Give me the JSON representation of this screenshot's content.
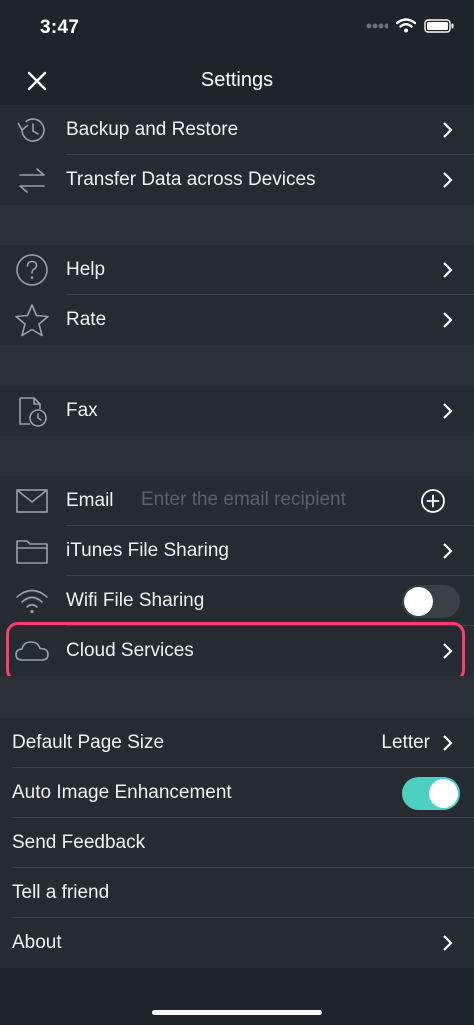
{
  "status": {
    "time": "3:47"
  },
  "nav": {
    "title": "Settings"
  },
  "sections": {
    "data": [
      {
        "label": "Backup and Restore",
        "icon": "history-icon"
      },
      {
        "label": "Transfer Data across Devices",
        "icon": "transfer-arrows-icon"
      }
    ],
    "support": [
      {
        "label": "Help",
        "icon": "question-circle-icon"
      },
      {
        "label": "Rate",
        "icon": "star-icon"
      }
    ],
    "fax": [
      {
        "label": "Fax",
        "icon": "fax-document-clock-icon"
      }
    ],
    "sharing": {
      "email": {
        "label": "Email",
        "placeholder": "Enter the email recipient",
        "value": ""
      },
      "itunes": {
        "label": "iTunes File Sharing"
      },
      "wifi": {
        "label": "Wifi File Sharing",
        "enabled": false
      },
      "cloud": {
        "label": "Cloud Services"
      }
    },
    "general": {
      "page_size": {
        "label": "Default Page Size",
        "value": "Letter"
      },
      "auto_enhance": {
        "label": "Auto Image Enhancement",
        "enabled": true
      },
      "feedback": {
        "label": "Send Feedback"
      },
      "tell_friend": {
        "label": "Tell a friend"
      },
      "about": {
        "label": "About"
      }
    }
  },
  "colors": {
    "background": "#1f242a",
    "row": "#262b31",
    "toggle_on": "#4dd0c1",
    "highlight": "#ff3d67"
  }
}
